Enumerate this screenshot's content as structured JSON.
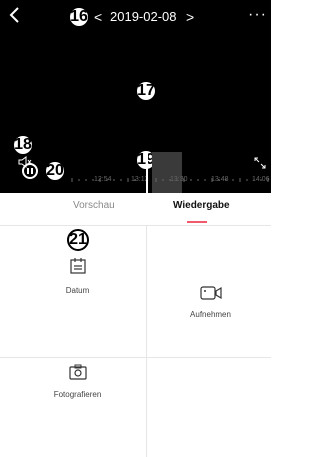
{
  "header": {
    "date": "2019-02-08",
    "prev_date_label": "<",
    "next_date_label": ">",
    "more_label": "···"
  },
  "markers": {
    "m16": "16",
    "m17": "17",
    "m18": "18",
    "m19": "19",
    "m20": "20",
    "m21": "21"
  },
  "timeline": {
    "tick_labels": [
      "12:54",
      "13:12",
      "13:30",
      "13:48",
      "14:06"
    ]
  },
  "tabs": [
    {
      "label": "Vorschau",
      "active": false
    },
    {
      "label": "Wiedergabe",
      "active": true
    }
  ],
  "options": [
    {
      "label": "Datum",
      "icon": "calendar-icon"
    },
    {
      "label": "Aufnehmen",
      "icon": "video-camera-icon"
    },
    {
      "label": "Fotografieren",
      "icon": "camera-icon"
    }
  ],
  "colors": {
    "accent": "#f05a6a",
    "video_bg": "#000000"
  }
}
